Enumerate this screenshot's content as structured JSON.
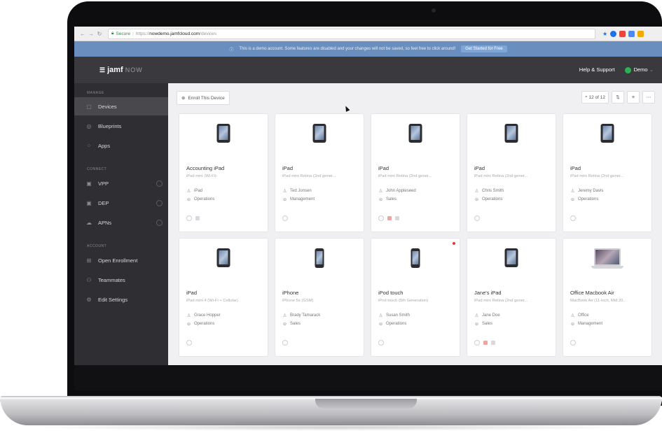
{
  "browser": {
    "secure_label": "Secure",
    "url_scheme": "https://",
    "url_host": "nowdemo.jamfcloud.com",
    "url_path": "/devices"
  },
  "banner": {
    "text": "This is a demo account. Some features are disabled and your changes will not be saved, so feel free to click around!",
    "button": "Get Started for Free"
  },
  "header": {
    "logo": "jamf",
    "logo_suffix": "NOW",
    "help": "Help & Support",
    "user": "Demo"
  },
  "sidebar": {
    "sections": [
      "MANAGE",
      "CONNECT",
      "ACCOUNT"
    ],
    "items": [
      {
        "label": "Devices",
        "icon": "devices-icon"
      },
      {
        "label": "Blueprints",
        "icon": "blueprints-icon"
      },
      {
        "label": "Apps",
        "icon": "apps-icon"
      },
      {
        "label": "VPP",
        "icon": "vpp-icon"
      },
      {
        "label": "DEP",
        "icon": "dep-icon"
      },
      {
        "label": "APNs",
        "icon": "apns-icon"
      },
      {
        "label": "Open Enrollment",
        "icon": "enrollment-icon"
      },
      {
        "label": "Teammates",
        "icon": "teammates-icon"
      },
      {
        "label": "Edit Settings",
        "icon": "settings-icon"
      }
    ]
  },
  "toolbar": {
    "enroll": "Enroll This Device",
    "count": "12 of 12"
  },
  "devices": [
    {
      "name": "Accounting iPad",
      "model": "iPad mini (Wi-Fi)",
      "user": "iPad",
      "group": "Operations",
      "type": "ipad"
    },
    {
      "name": "iPad",
      "model": "iPad mini Retina (2nd gener...",
      "user": "Ted Jonsen",
      "group": "Management",
      "type": "ipad"
    },
    {
      "name": "iPad",
      "model": "iPad mini Retina (2nd gener...",
      "user": "John Appleseed",
      "group": "Sales",
      "type": "ipad"
    },
    {
      "name": "iPad",
      "model": "iPad mini Retina (2nd gener...",
      "user": "Chris Smith",
      "group": "Operations",
      "type": "ipad"
    },
    {
      "name": "iPad",
      "model": "iPad mini Retina (2nd gener...",
      "user": "Jeremy Davis",
      "group": "Operations",
      "type": "ipad"
    },
    {
      "name": "iPad",
      "model": "iPad mini 4 (Wi-Fi + Cellular)",
      "user": "Grace Hopper",
      "group": "Operations",
      "type": "ipad"
    },
    {
      "name": "iPhone",
      "model": "iPhone 5s (GSM)",
      "user": "Brady Tamarack",
      "group": "Sales",
      "type": "iphone"
    },
    {
      "name": "iPod touch",
      "model": "iPod touch (5th Generation)",
      "user": "Susan Smith",
      "group": "Operations",
      "type": "iphone"
    },
    {
      "name": "Jane's iPad",
      "model": "iPad mini Retina (2nd gener...",
      "user": "Jane Doe",
      "group": "Sales",
      "type": "ipad"
    },
    {
      "name": "Office Macbook Air",
      "model": "MacBook Air (11-inch, Mid 20...",
      "user": "Office",
      "group": "Management",
      "type": "mac"
    }
  ]
}
